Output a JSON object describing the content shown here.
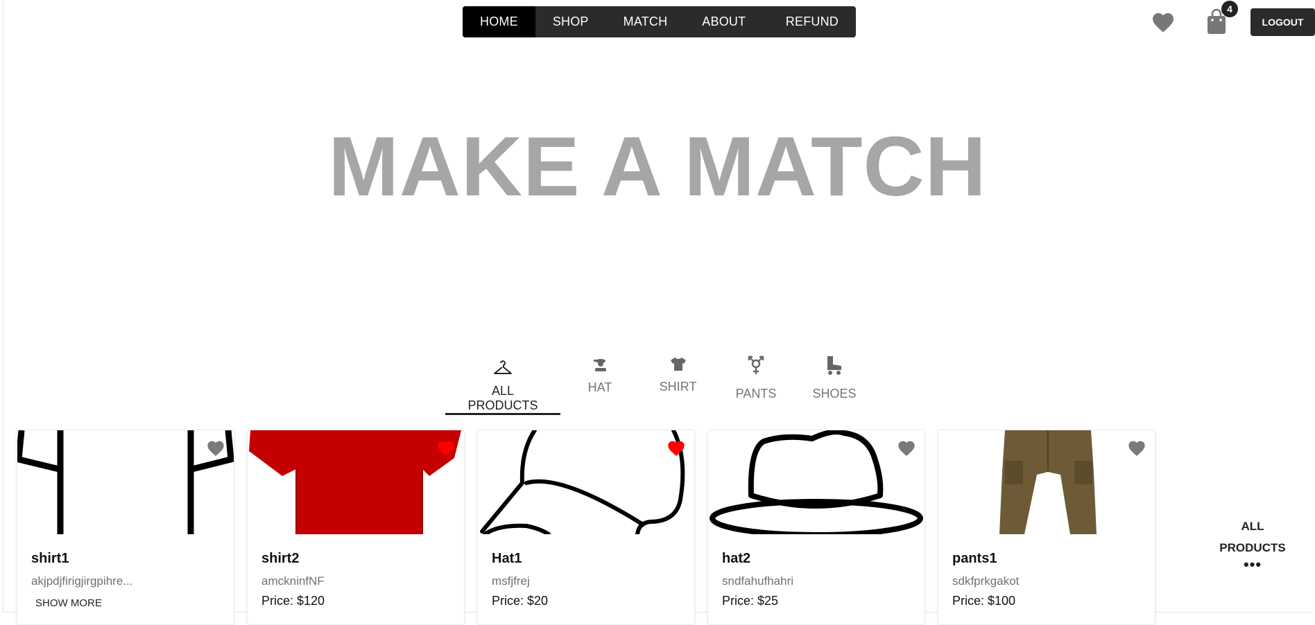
{
  "nav": {
    "items": [
      {
        "label": "HOME",
        "active": true
      },
      {
        "label": "SHOP",
        "active": false
      },
      {
        "label": "MATCH",
        "active": false
      },
      {
        "label": "ABOUT US",
        "active": false
      },
      {
        "label": "REFUND",
        "active": false
      }
    ]
  },
  "header": {
    "cart_count": "4",
    "logout_label": "LOGOUT",
    "icons": [
      "heart-icon",
      "shopping-bag-icon"
    ]
  },
  "hero": {
    "title": "MAKE A MATCH"
  },
  "categories": {
    "active": "ALL PRODUCTS",
    "items": [
      {
        "label": "ALL PRODUCTS",
        "icon": "hanger-icon"
      },
      {
        "label": "HAT",
        "icon": "hat-person-icon"
      },
      {
        "label": "SHIRT",
        "icon": "tshirt-icon"
      },
      {
        "label": "PANTS",
        "icon": "gender-symbol-icon"
      },
      {
        "label": "SHOES",
        "icon": "roller-skate-icon"
      }
    ]
  },
  "products": [
    {
      "name": "shirt1",
      "description": "akjpdjfirigjirgpihre...",
      "show_more": "SHOW MORE",
      "favorited": false,
      "image": "shirt-outline-drawing"
    },
    {
      "name": "shirt2",
      "description": "amckninfNF",
      "price": "Price: $120",
      "favorited": true,
      "image": "red-tshirt-photo"
    },
    {
      "name": "Hat1",
      "description": "msfjfrej",
      "price": "Price: $20",
      "favorited": true,
      "image": "cap-outline-drawing"
    },
    {
      "name": "hat2",
      "description": "sndfahufhahri",
      "price": "Price: $25",
      "favorited": false,
      "image": "fedora-outline-drawing"
    },
    {
      "name": "pants1",
      "description": "sdkfprkgakot",
      "price": "Price: $100",
      "favorited": false,
      "image": "cargo-pants-photo"
    }
  ],
  "all_products_link": {
    "line1": "ALL",
    "line2": "PRODUCTS",
    "dots": "•••"
  },
  "colors": {
    "nav_bg": "#2b2b2b",
    "nav_active": "#000000",
    "hero_text": "#a6a6a6",
    "favorite_active": "#ff0000",
    "favorite_inactive": "#7a7a7a",
    "shirt_red": "#c40000",
    "pants_olive": "#6e5a37"
  }
}
